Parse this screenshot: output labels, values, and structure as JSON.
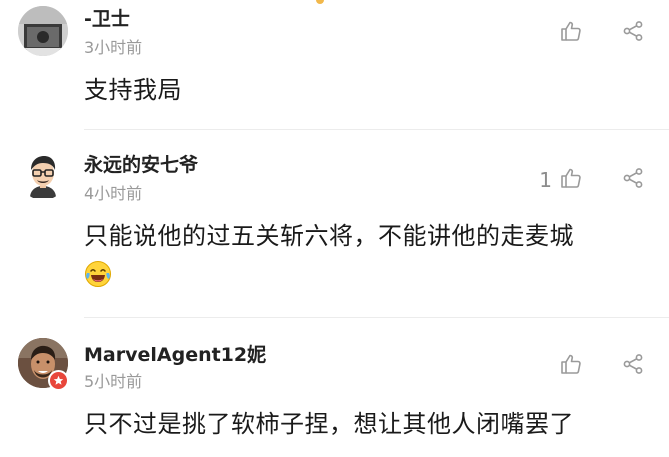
{
  "colors": {
    "username": "#222222",
    "timestamp": "#9a9a9a",
    "content": "#1a1a1a",
    "icon": "#9a9a9a",
    "divider": "#ececec",
    "badge": "#e8463b"
  },
  "comments": [
    {
      "username": "-卫士",
      "time": "3小时前",
      "text": "支持我局",
      "likes": "",
      "avatar_icon": "grayscale-photo-avatar"
    },
    {
      "username": "永远的安七爷",
      "time": "4小时前",
      "text": "只能说他的过五关斩六将，不能讲他的走麦城",
      "emoji": "laughing-crying-emoji",
      "likes": "1",
      "avatar_icon": "cartoon-man-glasses-avatar"
    },
    {
      "username": "MarvelAgent12妮",
      "time": "5小时前",
      "text": "只不过是挑了软柿子捏，想让其他人闭嘴罢了",
      "likes": "",
      "avatar_icon": "photo-avatar",
      "badge_icon": "star-badge-icon"
    }
  ]
}
